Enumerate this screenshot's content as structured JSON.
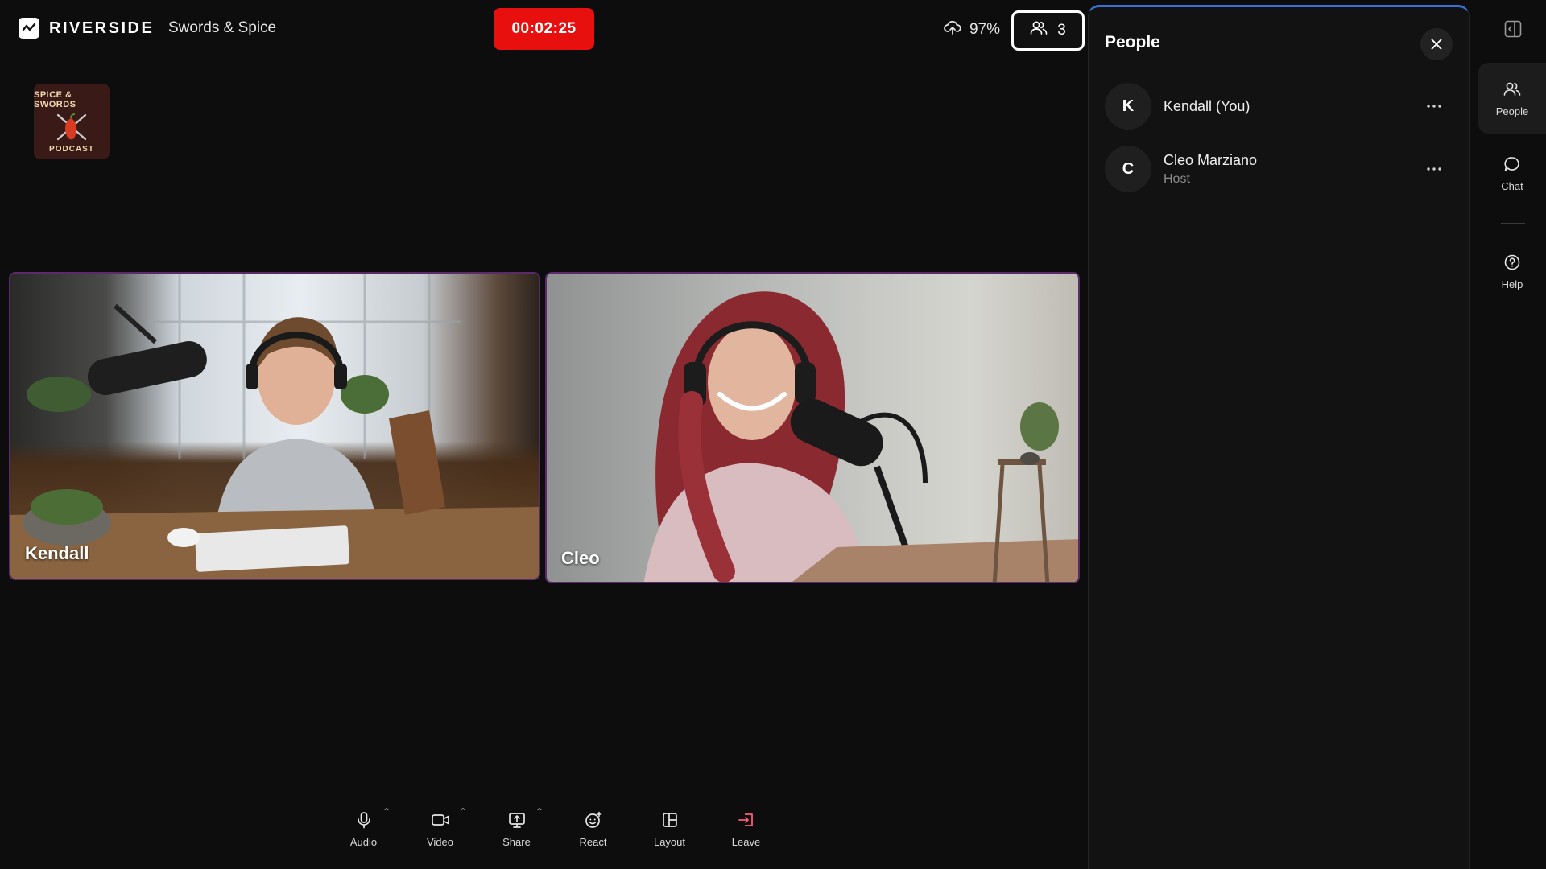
{
  "header": {
    "brand": "RIVERSIDE",
    "session_title": "Swords & Spice",
    "timer": "00:02:25",
    "upload_percent": "97%",
    "participant_count": "3"
  },
  "podcast_logo": {
    "top_text": "SPICE & SWORDS",
    "bottom_text": "PODCAST"
  },
  "tiles": [
    {
      "name": "Kendall"
    },
    {
      "name": "Cleo"
    }
  ],
  "toolbar": [
    {
      "label": "Audio",
      "icon": "mic-icon"
    },
    {
      "label": "Video",
      "icon": "camera-icon"
    },
    {
      "label": "Share",
      "icon": "share-screen-icon"
    },
    {
      "label": "React",
      "icon": "emoji-icon"
    },
    {
      "label": "Layout",
      "icon": "layout-icon"
    },
    {
      "label": "Leave",
      "icon": "leave-icon"
    }
  ],
  "people_panel": {
    "title": "People",
    "members": [
      {
        "initial": "K",
        "name": "Kendall (You)",
        "role": ""
      },
      {
        "initial": "C",
        "name": "Cleo Marziano",
        "role": "Host"
      }
    ]
  },
  "rail": {
    "people_label": "People",
    "chat_label": "Chat",
    "help_label": "Help"
  },
  "colors": {
    "recording": "#e8100f",
    "leave": "#ff5a7a",
    "panel_accent": "#3a6fd8",
    "tile_border": "#5a2a6a"
  }
}
